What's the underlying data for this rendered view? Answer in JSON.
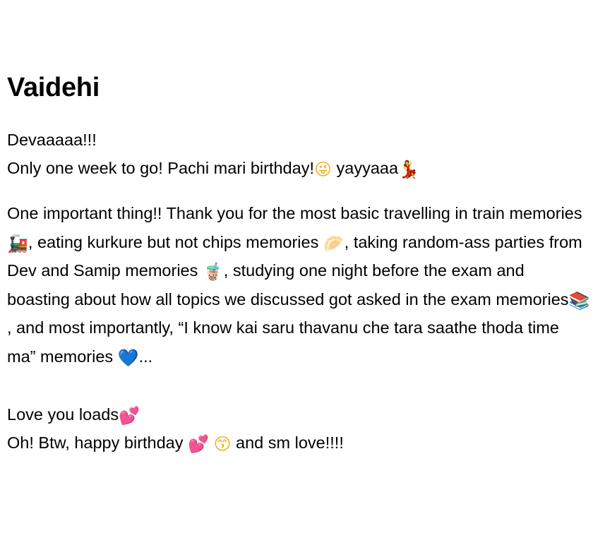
{
  "title": "Vaidehi",
  "greeting": {
    "line1": "Devaaaaa!!!",
    "line2": "Only one week to go! Pachi mari birthday!",
    "line2_tail": " yayyaaa"
  },
  "body": {
    "s1": "One important thing!! Thank you for the most basic travelling in train memories ",
    "s2": ", eating kurkure but not chips memories ",
    "s3": ", taking random-ass parties from Dev and Samip memories ",
    "s4": ", studying one night before the exam and boasting about how all topics we discussed got asked in the exam memories",
    "s5": ", and most importantly, “I know kai saru thavanu che tara saathe thoda time ma” memories ",
    "s6": "..."
  },
  "closing": {
    "line1": "Love you loads",
    "line2a": "Oh! Btw, happy birthday ",
    "line2b": " and sm love!!!!"
  },
  "emojis": {
    "winking_face": "😜",
    "dancer": "💃",
    "train": "🚂",
    "chip": "🥟",
    "bubble_tea": "🧋",
    "books": "📚",
    "blue_heart": "💙",
    "two_hearts": "💕",
    "kissing_face": "😙"
  }
}
